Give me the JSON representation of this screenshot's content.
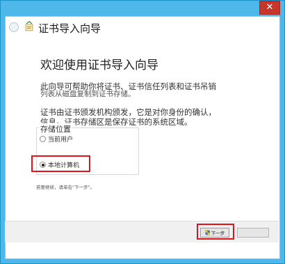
{
  "window": {
    "close_glyph": "✕"
  },
  "header": {
    "title": "证书导入向导"
  },
  "intro": {
    "heading": "欢迎使用证书导入向导",
    "para1_line1": "此向导可帮助你将证书、证书信任列表和证书吊销",
    "para1_line2": "列表从磁盘复制到证书存储。",
    "para2_line1": "证书由证书颁发机构颁发，它是对你身份的确认，",
    "para2_line2": "信息。证书存储区是保存证书的系统区域。"
  },
  "store_location": {
    "legend": "存储位置",
    "options": [
      {
        "label": "当前用户",
        "checked": false
      },
      {
        "label": "本地计算机",
        "checked": true
      }
    ]
  },
  "hint": "若要继续，请单击\"下一步\"。",
  "footer": {
    "next_label": "下一步"
  },
  "colors": {
    "accent": "#4fb8ea",
    "highlight": "#e0121a"
  },
  "icons": {
    "back": "back-arrow-icon",
    "wizard": "certificate-wizard-icon",
    "uac": "uac-shield-icon"
  }
}
